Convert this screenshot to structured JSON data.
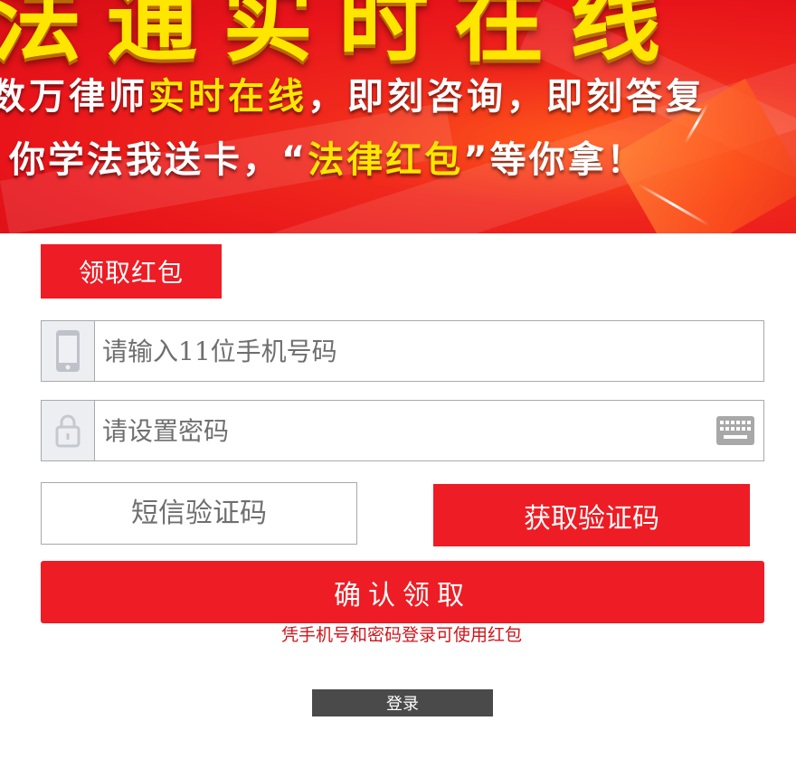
{
  "banner": {
    "headline": "法通实时在线",
    "line1_a": "数万律师",
    "line1_b": "实时在线",
    "line1_c": "，即刻咨询，即刻答复",
    "line2_a": "你学法我送卡，“",
    "line2_b": "法律红包",
    "line2_c": "”等你拿！"
  },
  "hongbao_button": "领取红包",
  "phone": {
    "placeholder": "请输入11位手机号码",
    "icon": "phone-icon"
  },
  "password": {
    "placeholder": "请设置密码",
    "icon": "lock-icon",
    "trailing_icon": "keyboard-icon"
  },
  "sms": {
    "placeholder": "短信验证码"
  },
  "get_code_button": "获取验证码",
  "confirm_button": "确认领取",
  "note": "凭手机号和密码登录可使用红包",
  "login_button": "登录",
  "colors": {
    "accent": "#ee1c24",
    "note": "#d0141a",
    "login_bg": "#4a4a4a"
  }
}
